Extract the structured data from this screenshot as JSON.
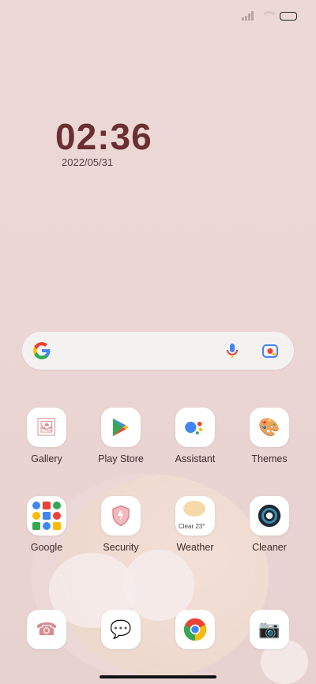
{
  "status_bar": {
    "icons": [
      "signal-icon",
      "wifi-icon",
      "battery-icon"
    ]
  },
  "clock": {
    "time": "02:36",
    "date": "2022/05/31"
  },
  "search_bar": {
    "icons": [
      "google-logo-icon",
      "microphone-icon",
      "lens-camera-icon"
    ]
  },
  "apps_row1": [
    {
      "label": "Gallery",
      "icon": "gallery-icon"
    },
    {
      "label": "Play Store",
      "icon": "play-store-icon"
    },
    {
      "label": "Assistant",
      "icon": "assistant-icon"
    },
    {
      "label": "Themes",
      "icon": "themes-icon"
    }
  ],
  "apps_row2": [
    {
      "label": "Google",
      "icon": "google-folder-icon"
    },
    {
      "label": "Security",
      "icon": "security-icon"
    },
    {
      "label": "Weather",
      "icon": "weather-icon",
      "badge": "Clear 23°"
    },
    {
      "label": "Cleaner",
      "icon": "cleaner-icon"
    }
  ],
  "dock": [
    {
      "icon": "phone-icon"
    },
    {
      "icon": "messages-icon"
    },
    {
      "icon": "chrome-icon"
    },
    {
      "icon": "camera-icon"
    }
  ],
  "colors": {
    "background": "#ecd9d7",
    "clock": "#6b2f33",
    "search": "#f4f1f1"
  }
}
